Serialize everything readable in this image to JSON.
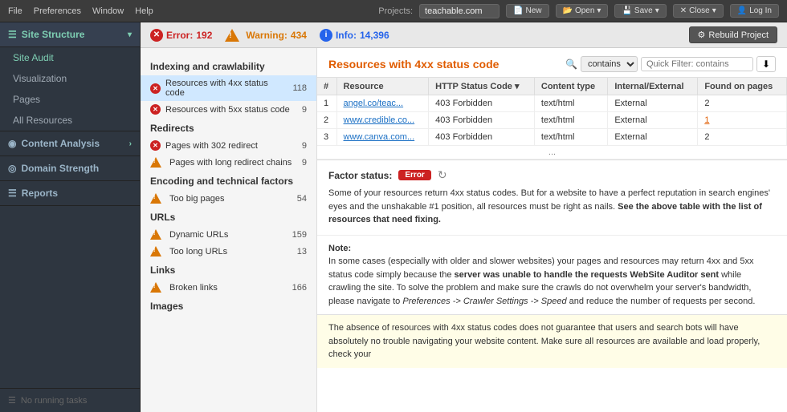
{
  "titleBar": {
    "menus": [
      "File",
      "Preferences",
      "Window",
      "Help"
    ],
    "projectsLabel": "Projects:",
    "projectValue": "teachable.com",
    "buttons": {
      "new": "New",
      "open": "Open",
      "save": "Save",
      "close": "Close",
      "logIn": "Log In"
    }
  },
  "sidebar": {
    "siteStructure": {
      "label": "Site Structure",
      "items": [
        {
          "id": "site-audit",
          "label": "Site Audit",
          "active": true
        },
        {
          "id": "visualization",
          "label": "Visualization",
          "active": false
        },
        {
          "id": "pages",
          "label": "Pages",
          "active": false
        },
        {
          "id": "all-resources",
          "label": "All Resources",
          "active": false
        }
      ]
    },
    "contentAnalysis": {
      "label": "Content Analysis",
      "arrow": "›"
    },
    "domainStrength": {
      "label": "Domain Strength"
    },
    "reports": {
      "label": "Reports"
    },
    "footer": {
      "label": "No running tasks"
    }
  },
  "statusBar": {
    "error": {
      "label": "Error:",
      "count": "192"
    },
    "warning": {
      "label": "Warning:",
      "count": "434"
    },
    "info": {
      "label": "Info:",
      "count": "14,396"
    },
    "rebuildButton": "Rebuild Project"
  },
  "leftPanel": {
    "sections": [
      {
        "id": "indexing",
        "title": "Indexing and crawlability",
        "items": [
          {
            "id": "4xx",
            "type": "error",
            "label": "Resources with 4xx status code",
            "count": "118",
            "selected": true
          },
          {
            "id": "5xx",
            "type": "error",
            "label": "Resources with 5xx status code",
            "count": "9"
          }
        ]
      },
      {
        "id": "redirects",
        "title": "Redirects",
        "items": [
          {
            "id": "302",
            "type": "error",
            "label": "Pages with 302 redirect",
            "count": "9"
          },
          {
            "id": "long-chains",
            "type": "warning",
            "label": "Pages with long redirect chains",
            "count": "9"
          }
        ]
      },
      {
        "id": "encoding",
        "title": "Encoding and technical factors",
        "items": [
          {
            "id": "big-pages",
            "type": "warning",
            "label": "Too big pages",
            "count": "54"
          }
        ]
      },
      {
        "id": "urls",
        "title": "URLs",
        "items": [
          {
            "id": "dynamic-urls",
            "type": "warning",
            "label": "Dynamic URLs",
            "count": "159"
          },
          {
            "id": "long-urls",
            "type": "warning",
            "label": "Too long URLs",
            "count": "13"
          }
        ]
      },
      {
        "id": "links",
        "title": "Links",
        "items": [
          {
            "id": "broken-links",
            "type": "warning",
            "label": "Broken links",
            "count": "166"
          }
        ]
      },
      {
        "id": "images",
        "title": "Images",
        "items": []
      }
    ]
  },
  "rightPanel": {
    "title": "Resources with 4xx status code",
    "filterPlaceholder": "Quick Filter: contains",
    "filterOptions": [
      "contains"
    ],
    "tableHeaders": [
      "#",
      "Resource",
      "HTTP Status Code",
      "Content type",
      "Internal/External",
      "Found on pages"
    ],
    "tableRows": [
      {
        "num": "1",
        "resource": "angel.co/teac...",
        "httpStatus": "403 Forbidden",
        "contentType": "text/html",
        "internalExternal": "External",
        "foundOnPages": "2"
      },
      {
        "num": "2",
        "resource": "www.credible.co...",
        "httpStatus": "403 Forbidden",
        "contentType": "text/html",
        "internalExternal": "External",
        "foundOnPages": "1"
      },
      {
        "num": "3",
        "resource": "www.canva.com...",
        "httpStatus": "403 Forbidden",
        "contentType": "text/html",
        "internalExternal": "External",
        "foundOnPages": "2"
      }
    ],
    "moreRowsIndicator": "...",
    "factorStatus": {
      "label": "Factor status:",
      "badge": "Error",
      "description": "Some of your resources return 4xx status codes. But for a website to have a perfect reputation in search engines' eyes and the unshakable #1 position, all resources must be right as nails.",
      "boldPart": "See the above table with the list of resources that need fixing.",
      "noteLabel": "Note:",
      "noteText": "In some cases (especially with older and slower websites) your pages and resources may return 4xx and 5xx status code simply because the",
      "noteBold1": "server was unable to handle the requests WebSite Auditor sent",
      "noteText2": "while crawling the site. To solve the problem and make sure the crawls do not overwhelm your server's bandwidth, please navigate to",
      "noteItalic": "Preferences -> Crawler Settings -> Speed",
      "noteText3": "and reduce the number of requests per second.",
      "highlightText": "The absence of resources with 4xx status codes does not guarantee that users and search bots will have absolutely no trouble navigating your website content. Make sure all resources are available and load properly, check your"
    }
  }
}
